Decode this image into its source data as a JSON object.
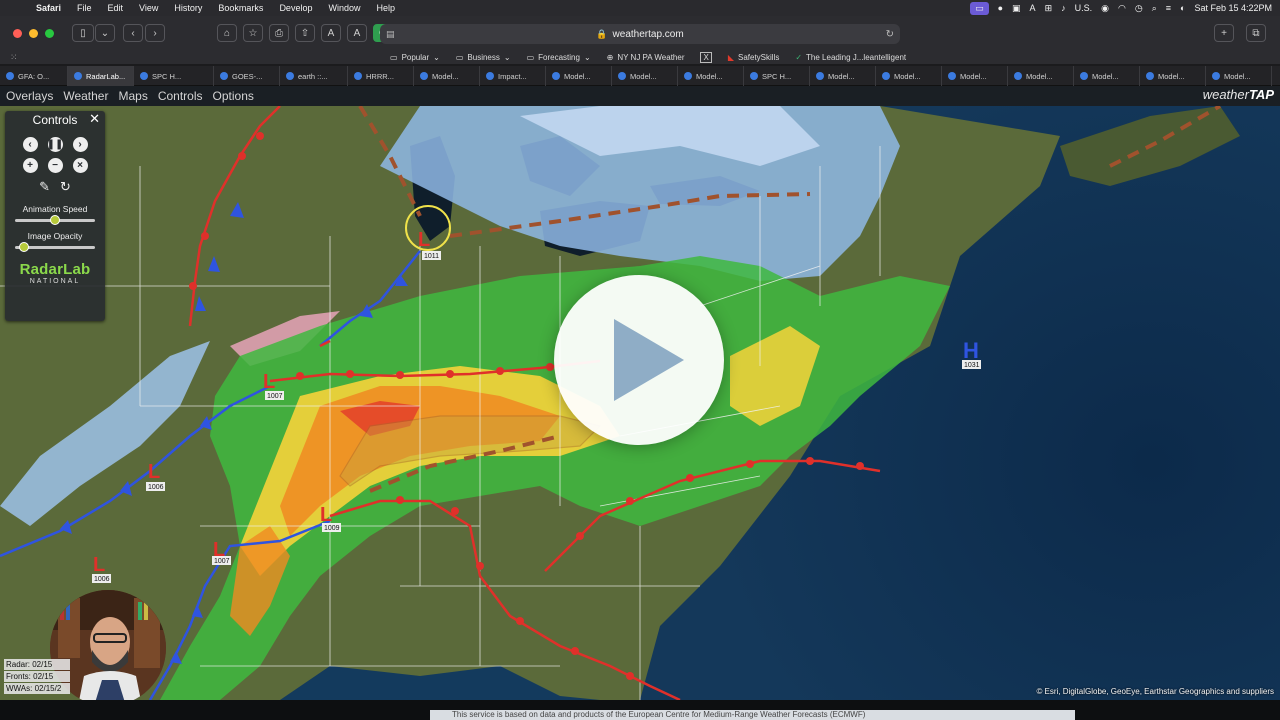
{
  "menubar": {
    "app_name": "Safari",
    "items": [
      "File",
      "Edit",
      "View",
      "History",
      "Bookmarks",
      "Develop",
      "Window",
      "Help"
    ],
    "status_input_source": "U.S.",
    "datetime": "Sat Feb 15  4:22PM"
  },
  "browser": {
    "url": "weathertap.com",
    "favorites": [
      "Popular",
      "Business",
      "Forecasting",
      "NY NJ PA Weather",
      "SafetySkills",
      "The Leading J...leantelligent"
    ],
    "tabs": [
      "GFA: O...",
      "RadarLab...",
      "SPC H...",
      "GOES-...",
      "earth ::...",
      "HRRR...",
      "Model...",
      "Impact...",
      "Model...",
      "Model...",
      "Model...",
      "SPC H...",
      "Model...",
      "Model...",
      "Model...",
      "Model...",
      "Model...",
      "Model...",
      "Model..."
    ],
    "active_tab": 1
  },
  "site": {
    "nav": [
      "Overlays",
      "Weather",
      "Maps",
      "Controls",
      "Options"
    ],
    "logo_text": "weather",
    "logo_bold": "TAP"
  },
  "controls": {
    "title": "Controls",
    "animation_speed_label": "Animation Speed",
    "animation_speed_level": 0.5,
    "image_opacity_label": "Image Opacity",
    "image_opacity_level": 0.05,
    "brand": "RadarLab",
    "brand_sub": "NATIONAL"
  },
  "map": {
    "pressure_labels": [
      "1011",
      "1031",
      "1007",
      "1006",
      "1009",
      "1007",
      "1006"
    ],
    "high_letter": "H",
    "low_letter": "L",
    "attribution": "© Esri, DigitalGlobe, GeoEye, Earthstar Geographics and suppliers"
  },
  "legend": [
    "Radar: 02/15",
    "Fronts: 02/15",
    "WWAs: 02/15/2"
  ],
  "footer_text": "This service is based on data and products of the European Centre for Medium-Range Weather Forecasts (ECMWF)"
}
